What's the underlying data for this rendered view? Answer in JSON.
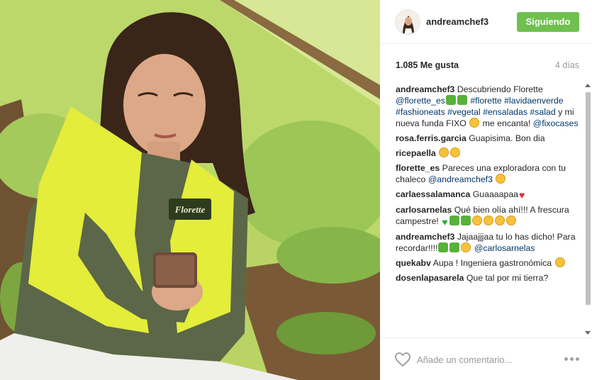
{
  "post": {
    "username": "andreamchef3",
    "follow_label": "Siguiendo",
    "likes": "1.085 Me gusta",
    "time_ago": "4 días"
  },
  "comments": [
    {
      "author": "andreamchef3",
      "parts": [
        {
          "t": "text",
          "v": "Descubriendo Florette "
        },
        {
          "t": "tag",
          "v": "@florette_es"
        },
        {
          "t": "emoji",
          "v": "seedling",
          "c": "grn"
        },
        {
          "t": "emoji",
          "v": "four-leaf-clover",
          "c": "grn"
        },
        {
          "t": "text",
          "v": " "
        },
        {
          "t": "tag",
          "v": "#florette"
        },
        {
          "t": "text",
          "v": " "
        },
        {
          "t": "tag",
          "v": "#lavidaenverde"
        },
        {
          "t": "text",
          "v": " "
        },
        {
          "t": "tag",
          "v": "#fashioneats"
        },
        {
          "t": "text",
          "v": " "
        },
        {
          "t": "tag",
          "v": "#vegetal"
        },
        {
          "t": "text",
          "v": " "
        },
        {
          "t": "tag",
          "v": "#ensaladas"
        },
        {
          "t": "text",
          "v": " "
        },
        {
          "t": "tag",
          "v": "#salad"
        },
        {
          "t": "text",
          "v": " y mi nueva funda FIXO "
        },
        {
          "t": "emoji",
          "v": "smile",
          "c": "yel"
        },
        {
          "t": "text",
          "v": " me encanta! "
        },
        {
          "t": "tag",
          "v": "@fixocases"
        }
      ]
    },
    {
      "author": "rosa.ferris.garcia",
      "parts": [
        {
          "t": "text",
          "v": "Guapisima. Bon dia"
        }
      ]
    },
    {
      "author": "ricepaella",
      "parts": [
        {
          "t": "emoji",
          "v": "heart-eyes",
          "c": "yel"
        },
        {
          "t": "emoji",
          "v": "kiss",
          "c": "yel"
        }
      ]
    },
    {
      "author": "florette_es",
      "parts": [
        {
          "t": "text",
          "v": "Pareces una exploradora con tu chaleco "
        },
        {
          "t": "tag",
          "v": "@andreamchef3"
        },
        {
          "t": "text",
          "v": " "
        },
        {
          "t": "emoji",
          "v": "grin",
          "c": "yel"
        }
      ]
    },
    {
      "author": "carlaessalamanca",
      "parts": [
        {
          "t": "text",
          "v": "Guaaaapaa"
        },
        {
          "t": "emoji",
          "v": "red-heart",
          "c": "heart-r"
        }
      ]
    },
    {
      "author": "carlosarnelas",
      "parts": [
        {
          "t": "text",
          "v": "Qué bien olía ahí!!! A frescura campestre! "
        },
        {
          "t": "emoji",
          "v": "green-heart",
          "c": "heart-g"
        },
        {
          "t": "emoji",
          "v": "leaf",
          "c": "grn"
        },
        {
          "t": "emoji",
          "v": "herb",
          "c": "grn"
        },
        {
          "t": "emoji",
          "v": "ok-hand",
          "c": "yel"
        },
        {
          "t": "emoji",
          "v": "sparkles",
          "c": "yel"
        },
        {
          "t": "emoji",
          "v": "smiling-face",
          "c": "yel"
        },
        {
          "t": "emoji",
          "v": "blush",
          "c": "yel"
        }
      ]
    },
    {
      "author": "andreamchef3",
      "parts": [
        {
          "t": "text",
          "v": "Jajaajjjaa tu lo has dicho! Para recordar!!!!"
        },
        {
          "t": "emoji",
          "v": "clover",
          "c": "grn"
        },
        {
          "t": "emoji",
          "v": "herb",
          "c": "grn"
        },
        {
          "t": "emoji",
          "v": "yum",
          "c": "yel"
        },
        {
          "t": "text",
          "v": " "
        },
        {
          "t": "tag",
          "v": "@carlosarnelas"
        }
      ]
    },
    {
      "author": "quekabv",
      "parts": [
        {
          "t": "text",
          "v": "Aupa ! Ingeniera gastronómica "
        },
        {
          "t": "emoji",
          "v": "flexed-biceps",
          "c": "yel"
        }
      ]
    },
    {
      "author": "dosenlapasarela",
      "parts": [
        {
          "t": "text",
          "v": "Que tal por mi tierra?"
        }
      ]
    }
  ],
  "footer": {
    "comment_placeholder": "Añade un comentario..."
  },
  "photo": {
    "vest_logo": "Florette"
  },
  "colors": {
    "follow_button": "#70c050",
    "link": "#003569",
    "meta": "#999999"
  }
}
